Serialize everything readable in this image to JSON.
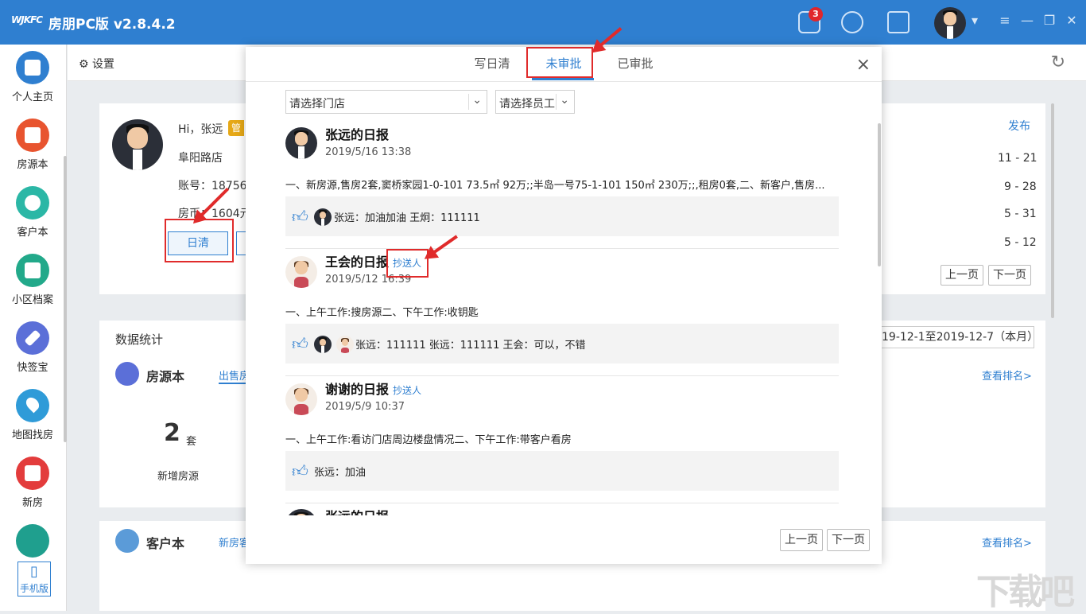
{
  "app": {
    "title": "房朋PC版 v2.8.4.2",
    "logo": "WJKFC",
    "notif_count": "3"
  },
  "sidebar": {
    "items": [
      {
        "label": "个人主页",
        "color": "#2f7fd0"
      },
      {
        "label": "房源本",
        "color": "#e8542f"
      },
      {
        "label": "客户本",
        "color": "#2bb7a6"
      },
      {
        "label": "小区档案",
        "color": "#22a98a"
      },
      {
        "label": "快签宝",
        "color": "#5b6fd8"
      },
      {
        "label": "地图找房",
        "color": "#2f9bd8"
      },
      {
        "label": "新房",
        "color": "#e33c3c"
      },
      {
        "label": "",
        "color": "#1f9f8e"
      }
    ],
    "phone_label": "手机版"
  },
  "subbar": {
    "settings": "设置"
  },
  "profile": {
    "greeting": "Hi，张远",
    "role_badge": "管",
    "store": "阜阳路店",
    "account": "账号：18756",
    "coins": "房币：1604元",
    "daily_btn": "日清"
  },
  "right_panel": {
    "publish": "发布",
    "dates": [
      "11 - 21",
      "9 - 28",
      "5 - 31",
      "5 - 12"
    ],
    "prev": "上一页",
    "next": "下一页",
    "range": "19-12-1至2019-12-7（本月）"
  },
  "stats": {
    "title": "数据统计",
    "house": {
      "title": "房源本",
      "tab": "出售房",
      "value": "2",
      "unit": "套",
      "label": "新增房源",
      "rank": "查看排名>"
    },
    "customer": {
      "title": "客户本",
      "tab": "新房客",
      "rank": "查看排名>"
    }
  },
  "modal": {
    "tabs": [
      {
        "label": "写日清"
      },
      {
        "label": "未审批"
      },
      {
        "label": "已审批"
      }
    ],
    "close": "×",
    "store_select": "请选择门店",
    "staff_select": "请选择员工",
    "reports": [
      {
        "name": "张远的日报",
        "tag": "",
        "time": "2019/5/16 13:38",
        "text": "一、新房源,售房2套,窦桥家园1-0-101 73.5㎡ 92万;;半岛一号75-1-101 150㎡ 230万;;,租房0套,二、新客户,售房...",
        "comments": "张远：加油加油    王炯：111111",
        "avatar": "man"
      },
      {
        "name": "王会的日报",
        "tag": "抄送人",
        "time": "2019/5/12 16:39",
        "text": "一、上午工作:搜房源二、下午工作:收钥匙",
        "comments": "张远：111111    张远：111111    王会：可以，不错",
        "avatar": "girl"
      },
      {
        "name": "谢谢的日报",
        "tag": "抄送人",
        "time": "2019/5/9 10:37",
        "text": "一、上午工作:看访门店周边楼盘情况二、下午工作:带客户看房",
        "comments": "张远：加油",
        "avatar": "girl"
      },
      {
        "name": "张远的日报",
        "tag": "",
        "time": "",
        "text": "",
        "comments": "",
        "avatar": "man"
      }
    ],
    "prev": "上一页",
    "next": "下一页"
  },
  "watermark": "下载吧"
}
